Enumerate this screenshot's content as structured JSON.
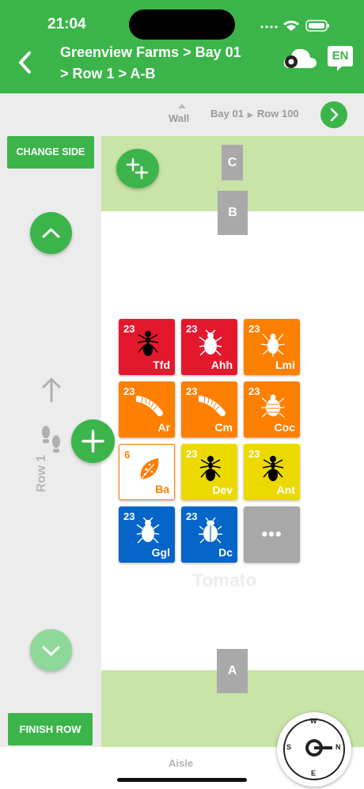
{
  "status_bar": {
    "time": "21:04"
  },
  "header": {
    "title_line1": "Greenview Farms > Bay 01",
    "title_line2": "> Row 1 > A-B",
    "language": "EN"
  },
  "nav": {
    "wall_label": "Wall",
    "crumb_bay": "Bay 01",
    "crumb_row": "Row 100"
  },
  "left_panel": {
    "change_side_label": "CHANGE SIDE",
    "finish_row_label": "FINISH ROW",
    "row_label": "Row 1"
  },
  "map": {
    "tag_c": "C",
    "tag_b": "B",
    "tag_a": "A",
    "crop_label": "Tomato",
    "aisle_label": "Aisle"
  },
  "tiles": [
    {
      "count": "23",
      "code": "Tfd",
      "color": "#e3182d",
      "icon": "ant-icon"
    },
    {
      "count": "23",
      "code": "Ahh",
      "color": "#e3182d",
      "icon": "mite-icon"
    },
    {
      "count": "23",
      "code": "Lmi",
      "color": "#ff7f00",
      "icon": "spider-mite-icon"
    },
    {
      "count": "23",
      "code": "Ar",
      "color": "#ff7f00",
      "icon": "caterpillar-icon"
    },
    {
      "count": "23",
      "code": "Cm",
      "color": "#ff7f00",
      "icon": "caterpillar-icon"
    },
    {
      "count": "23",
      "code": "Coc",
      "color": "#ff7f00",
      "icon": "scale-insect-icon"
    },
    {
      "count": "6",
      "code": "Ba",
      "color": "#ffffff",
      "icon": "leaf-disease-icon"
    },
    {
      "count": "23",
      "code": "Dev",
      "color": "#ecd900",
      "icon": "ant-icon"
    },
    {
      "count": "23",
      "code": "Ant",
      "color": "#ecd900",
      "icon": "ant-icon"
    },
    {
      "count": "23",
      "code": "Ggl",
      "color": "#0565c8",
      "icon": "mite-icon"
    },
    {
      "count": "23",
      "code": "Dc",
      "color": "#0565c8",
      "icon": "beetle-icon"
    }
  ],
  "more_label": "•••",
  "compass": {
    "n": "N",
    "e": "E",
    "s": "S",
    "w": "W"
  }
}
